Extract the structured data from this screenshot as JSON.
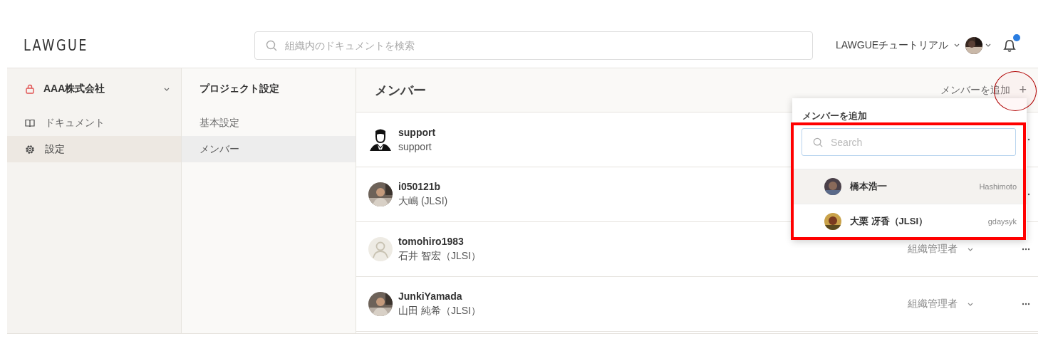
{
  "logo": "LAWGUE",
  "search": {
    "placeholder": "組織内のドキュメントを検索"
  },
  "header": {
    "workspace": "LAWGUEチュートリアル",
    "notification": true
  },
  "sidebar": {
    "org": "AAA株式会社",
    "items": [
      {
        "label": "ドキュメント",
        "selected": false
      },
      {
        "label": "設定",
        "selected": true
      }
    ]
  },
  "settings_nav": {
    "title": "プロジェクト設定",
    "items": [
      {
        "label": "基本設定",
        "selected": false
      },
      {
        "label": "メンバー",
        "selected": true
      }
    ]
  },
  "members": {
    "title": "メンバー",
    "add_label": "メンバーを追加",
    "add_icon": "+",
    "rows": [
      {
        "username": "support",
        "name": "support",
        "kind": "silhouette"
      },
      {
        "username": "i050121b",
        "name": "大嶋 (JLSI)"
      },
      {
        "username": "tomohiro1983",
        "name": "石井 智宏（JLSI）",
        "kind": "placeholder",
        "role": "組織管理者"
      },
      {
        "username": "JunkiYamada",
        "name": "山田 純希（JLSI）",
        "role": "組織管理者"
      }
    ]
  },
  "add_popup": {
    "title": "メンバーを追加",
    "search_placeholder": "Search",
    "results": [
      {
        "name": "橋本浩一",
        "handle": "Hashimoto",
        "selected": true
      },
      {
        "name": "大栗 冴香（JLSI）",
        "handle": "gdaysyk",
        "selected": false
      }
    ]
  },
  "annotations": [
    {
      "kind": "rect",
      "color": "#ff0000"
    },
    {
      "kind": "ellipse",
      "color": "#b00000"
    }
  ]
}
